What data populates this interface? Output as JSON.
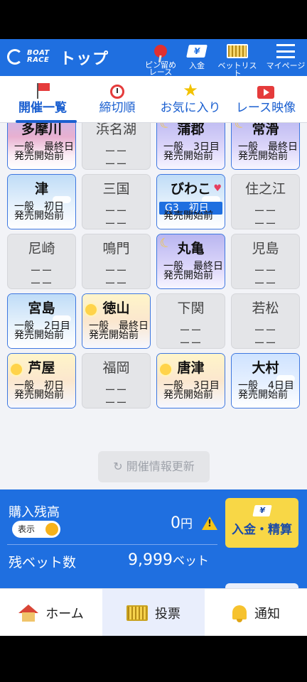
{
  "header": {
    "brand_line1": "BOAT",
    "brand_line2": "RACE",
    "title": "トップ",
    "actions": [
      {
        "label": "ピン留め\nレース",
        "icon": "pin-icon"
      },
      {
        "label": "入金",
        "icon": "yen-card-icon"
      },
      {
        "label": "ベットリスト",
        "icon": "bet-list-icon"
      },
      {
        "label": "マイページ",
        "icon": "menu-icon"
      }
    ],
    "yen_symbol": "¥"
  },
  "tabs": [
    {
      "label": "開催一覧",
      "icon": "flag-icon",
      "active": true
    },
    {
      "label": "締切順",
      "icon": "clock-icon",
      "active": false
    },
    {
      "label": "お気に入り",
      "icon": "star-icon",
      "active": false
    },
    {
      "label": "レース映像",
      "icon": "video-icon",
      "active": false
    }
  ],
  "venues": [
    {
      "name": "多摩川",
      "open": true,
      "theme": "dusk",
      "line1": "一般　最終日",
      "line2": "発売開始前"
    },
    {
      "name": "浜名湖",
      "open": false,
      "dash": "ーー"
    },
    {
      "name": "蒲郡",
      "open": true,
      "theme": "night",
      "line1": "一般　3日目",
      "line2": "発売開始前"
    },
    {
      "name": "常滑",
      "open": true,
      "theme": "night",
      "line1": "一般　最終日",
      "line2": "発売開始前"
    },
    {
      "name": "津",
      "open": true,
      "theme": "day",
      "line1": "一般　初日",
      "line2": "発売開始前"
    },
    {
      "name": "三国",
      "open": false,
      "dash": "ーー"
    },
    {
      "name": "びわこ",
      "open": true,
      "theme": "day",
      "grade": "G3　初日",
      "line2": "発売開始前",
      "favorite": true
    },
    {
      "name": "住之江",
      "open": false,
      "dash": "ーー"
    },
    {
      "name": "尼崎",
      "open": false,
      "dash": "ーー"
    },
    {
      "name": "鳴門",
      "open": false,
      "dash": "ーー"
    },
    {
      "name": "丸亀",
      "open": true,
      "theme": "night",
      "line1": "一般　最終日",
      "line2": "発売開始前"
    },
    {
      "name": "児島",
      "open": false,
      "dash": "ーー"
    },
    {
      "name": "宮島",
      "open": true,
      "theme": "day",
      "line1": "一般　2日目",
      "line2": "発売開始前"
    },
    {
      "name": "徳山",
      "open": true,
      "theme": "morning",
      "line1": "一般　最終日",
      "line2": "発売開始前"
    },
    {
      "name": "下関",
      "open": false,
      "dash": "ーー"
    },
    {
      "name": "若松",
      "open": false,
      "dash": "ーー"
    },
    {
      "name": "芦屋",
      "open": true,
      "theme": "morning",
      "line1": "一般　初日",
      "line2": "発売開始前"
    },
    {
      "name": "福岡",
      "open": false,
      "dash": "ーー"
    },
    {
      "name": "唐津",
      "open": true,
      "theme": "morning",
      "line1": "一般　3日目",
      "line2": "発売開始前"
    },
    {
      "name": "大村",
      "open": true,
      "theme": "stars",
      "line1": "一般　4日目",
      "line2": "発売開始前"
    }
  ],
  "refresh_button": "開催情報更新",
  "balance": {
    "title": "購入残高",
    "toggle_label": "表示",
    "amount": "0",
    "amount_unit": "円",
    "bets_label": "残ベット数",
    "bets_value": "9,999",
    "bets_unit": "ベット",
    "deposit_button": "入金・精算"
  },
  "bottom_nav": [
    {
      "label": "ホーム",
      "icon": "home-icon"
    },
    {
      "label": "投票",
      "icon": "ticket-icon",
      "active": true
    },
    {
      "label": "通知",
      "icon": "bell-icon"
    }
  ],
  "colors": {
    "primary": "#1f6fe0",
    "accent_yellow": "#f8d746",
    "favorite": "#e63e5f"
  }
}
